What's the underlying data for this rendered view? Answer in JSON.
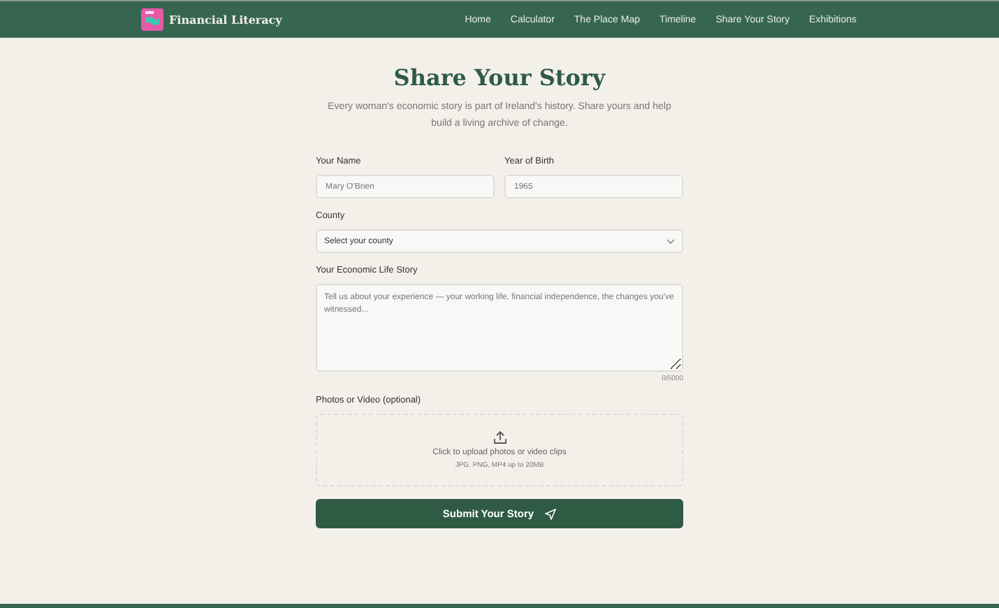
{
  "header": {
    "brand": "Financial Literacy",
    "nav": [
      "Home",
      "Calculator",
      "The Place Map",
      "Timeline",
      "Share Your Story",
      "Exhibitions"
    ]
  },
  "page": {
    "title": "Share Your Story",
    "intro": "Every woman's economic story is part of Ireland's history. Share yours and help build a living archive of change."
  },
  "form": {
    "name": {
      "label": "Your Name",
      "placeholder": "Mary O'Brien"
    },
    "year": {
      "label": "Year of Birth",
      "placeholder": "1965"
    },
    "county": {
      "label": "County",
      "placeholder": "Select your county"
    },
    "story": {
      "label": "Your Economic Life Story",
      "placeholder": "Tell us about your experience — your working life, financial independence, the changes you've witnessed...",
      "counter": "0/5000"
    },
    "upload": {
      "label": "Photos or Video (optional)",
      "prompt": "Click to upload photos or video clips",
      "hint": "JPG, PNG, MP4 up to 20MB"
    },
    "submit": "Submit Your Story"
  }
}
